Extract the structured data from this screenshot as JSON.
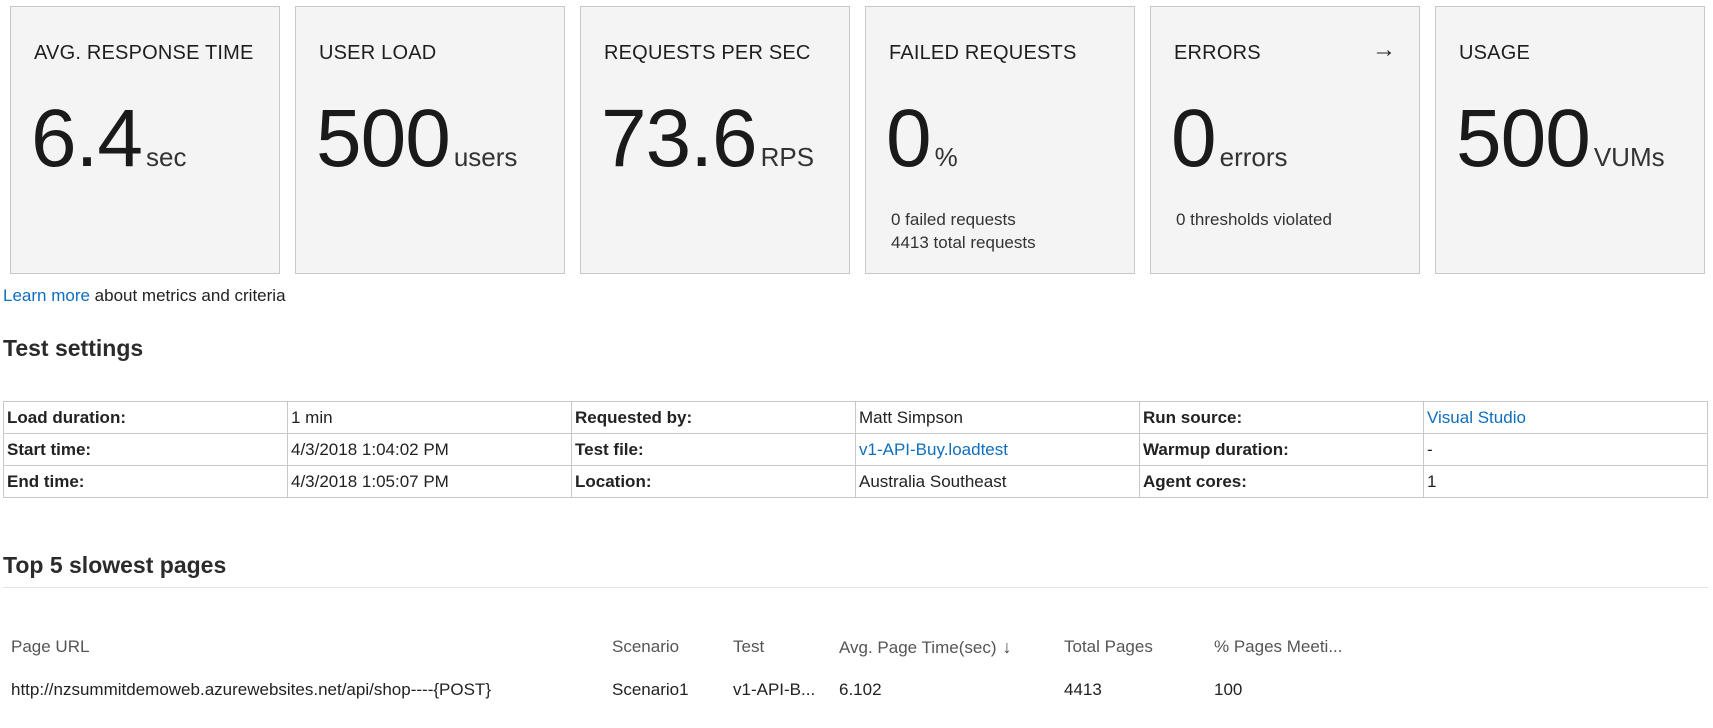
{
  "tiles": [
    {
      "title": "AVG. RESPONSE TIME",
      "value": "6.4",
      "unit": "sec"
    },
    {
      "title": "USER LOAD",
      "value": "500",
      "unit": "users"
    },
    {
      "title": "REQUESTS PER SEC",
      "value": "73.6",
      "unit": "RPS"
    },
    {
      "title": "FAILED REQUESTS",
      "value": "0",
      "unit": "%",
      "line1": "0 failed requests",
      "line2": "4413 total requests"
    },
    {
      "title": "ERRORS",
      "value": "0",
      "unit": "errors",
      "line1": "0 thresholds violated",
      "icon": "arrow-right-icon"
    },
    {
      "title": "USAGE",
      "value": "500",
      "unit": "VUMs"
    }
  ],
  "learn": {
    "link": "Learn more",
    "text": " about metrics and criteria"
  },
  "settings": {
    "title": "Test settings",
    "load_duration_label": "Load duration:",
    "load_duration": "1 min",
    "requested_by_label": "Requested by:",
    "requested_by": "Matt Simpson",
    "run_source_label": "Run source:",
    "run_source": "Visual Studio",
    "start_time_label": "Start time:",
    "start_time": "4/3/2018 1:04:02 PM",
    "test_file_label": "Test file:",
    "test_file": "v1-API-Buy.loadtest",
    "warmup_label": "Warmup duration:",
    "warmup": "-",
    "end_time_label": "End time:",
    "end_time": "4/3/2018 1:05:07 PM",
    "location_label": "Location:",
    "location": "Australia Southeast",
    "agent_cores_label": "Agent cores:",
    "agent_cores": "1"
  },
  "slowest": {
    "title": "Top 5 slowest pages",
    "columns": {
      "page_url": "Page URL",
      "scenario": "Scenario",
      "test": "Test",
      "avg_time": "Avg. Page Time(sec)",
      "total_pages": "Total Pages",
      "pct_meeting": "% Pages Meeti..."
    },
    "sort_icon": "arrow-down-icon",
    "rows": [
      {
        "page_url": "http://nzsummitdemoweb.azurewebsites.net/api/shop----{POST}",
        "scenario": "Scenario1",
        "test": "v1-API-B...",
        "avg_time": "6.102",
        "total_pages": "4413",
        "pct_meeting": "100"
      }
    ]
  },
  "colors": {
    "link": "#106ebe",
    "tile_bg": "#f4f4f4",
    "border": "#c8c8c8"
  }
}
